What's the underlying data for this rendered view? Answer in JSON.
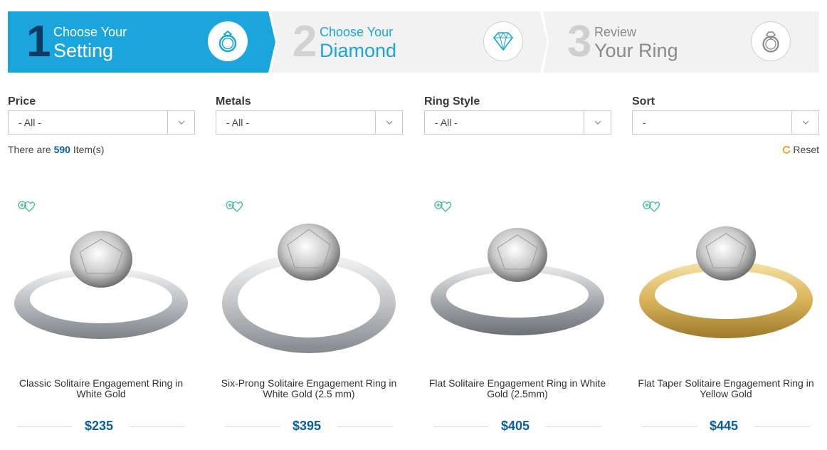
{
  "steps": [
    {
      "number": "1",
      "line1": "Choose Your",
      "line2": "Setting",
      "icon": "ring-icon"
    },
    {
      "number": "2",
      "line1": "Choose Your",
      "line2": "Diamond",
      "icon": "diamond-icon"
    },
    {
      "number": "3",
      "line1": "Review",
      "line2": "Your Ring",
      "icon": "engagement-ring-icon"
    }
  ],
  "filters": [
    {
      "label": "Price",
      "value": "- All -"
    },
    {
      "label": "Metals",
      "value": "- All -"
    },
    {
      "label": "Ring Style",
      "value": "- All -"
    },
    {
      "label": "Sort",
      "value": "-"
    }
  ],
  "results": {
    "prefix": "There are",
    "count": "590",
    "suffix": "Item(s)"
  },
  "reset_label": "Reset",
  "colors": {
    "accent": "#1aa6dc",
    "dark_blue": "#0b3a63",
    "price": "#0b5e98",
    "wishlist": "#3fb89a",
    "gold": "#d9b45a"
  },
  "products": [
    {
      "name": "Classic Solitaire Engagement Ring in White Gold",
      "price": "$235",
      "metal": "white"
    },
    {
      "name": "Six-Prong Solitaire Engagement Ring in White Gold (2.5 mm)",
      "price": "$395",
      "metal": "white"
    },
    {
      "name": "Flat Solitaire Engagement Ring in White Gold (2.5mm)",
      "price": "$405",
      "metal": "white"
    },
    {
      "name": "Flat Taper Solitaire Engagement Ring in Yellow Gold",
      "price": "$445",
      "metal": "yellow"
    }
  ]
}
